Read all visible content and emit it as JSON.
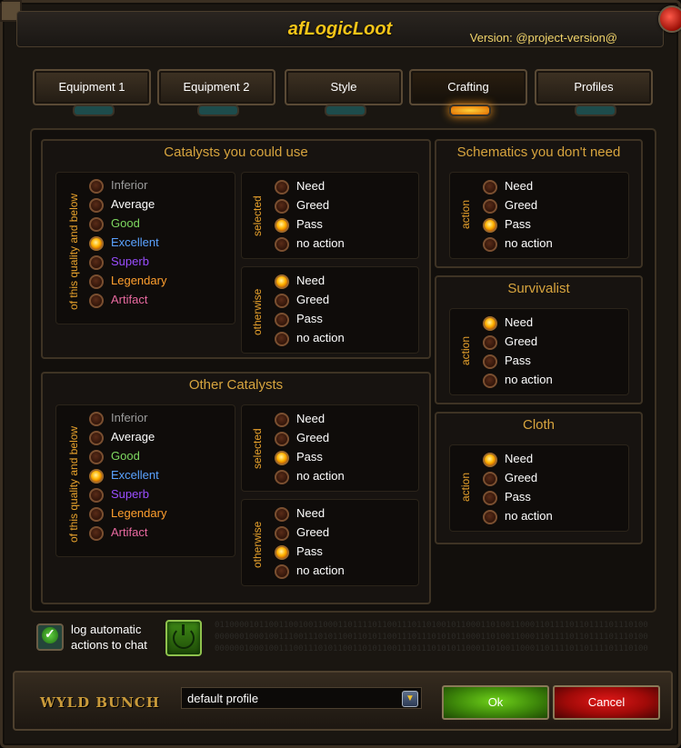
{
  "window": {
    "title": "afLogicLoot",
    "version": "Version: @project-version@"
  },
  "tabs": [
    {
      "label": "Equipment 1",
      "active": false
    },
    {
      "label": "Equipment 2",
      "active": false
    },
    {
      "label": "Style",
      "active": false
    },
    {
      "label": "Crafting",
      "active": true
    },
    {
      "label": "Profiles",
      "active": false
    }
  ],
  "catalysts_use": {
    "title": "Catalysts you could use",
    "quality_label": "of this quality and below",
    "selected_label": "selected",
    "otherwise_label": "otherwise",
    "qualities": [
      "Inferior",
      "Average",
      "Good",
      "Excellent",
      "Superb",
      "Legendary",
      "Artifact"
    ],
    "quality_selected": "Excellent",
    "selected_options": [
      "Need",
      "Greed",
      "Pass",
      "no action"
    ],
    "selected_choice": "Pass",
    "otherwise_options": [
      "Need",
      "Greed",
      "Pass",
      "no action"
    ],
    "otherwise_choice": "Need"
  },
  "catalysts_other": {
    "title": "Other Catalysts",
    "quality_label": "of this quality and below",
    "selected_label": "selected",
    "otherwise_label": "otherwise",
    "qualities": [
      "Inferior",
      "Average",
      "Good",
      "Excellent",
      "Superb",
      "Legendary",
      "Artifact"
    ],
    "quality_selected": "Excellent",
    "selected_options": [
      "Need",
      "Greed",
      "Pass",
      "no action"
    ],
    "selected_choice": "Pass",
    "otherwise_options": [
      "Need",
      "Greed",
      "Pass",
      "no action"
    ],
    "otherwise_choice": "Pass"
  },
  "schematics": {
    "title": "Schematics you don't need",
    "action_label": "action",
    "options": [
      "Need",
      "Greed",
      "Pass",
      "no action"
    ],
    "choice": "Pass"
  },
  "survivalist": {
    "title": "Survivalist",
    "action_label": "action",
    "options": [
      "Need",
      "Greed",
      "Pass",
      "no action"
    ],
    "choice": "Need"
  },
  "cloth": {
    "title": "Cloth",
    "action_label": "action",
    "options": [
      "Need",
      "Greed",
      "Pass",
      "no action"
    ],
    "choice": "Need"
  },
  "quality_colors": {
    "Inferior": "#9d9d9d",
    "Average": "#ffffff",
    "Good": "#7ed860",
    "Excellent": "#5aa2ff",
    "Superb": "#9a4dff",
    "Legendary": "#ff9f2e",
    "Artifact": "#e96aa0"
  },
  "footer": {
    "log_label": "log automatic actions to chat",
    "log_checked": true,
    "binary_text": "0110000101100110010011000110111101100111011010010110001101001100011011110110111101110100000000100010011100111010110011010110011101110101011000110100110001101111011011110111010000000010001001110011101011001101011001110111010101100011010011000110111101101111011101000000001000100111001110101100110101100111011101010110001101001100011011110110111101110100"
  },
  "bottom": {
    "brand": "WYLD BUNCH",
    "profile_value": "default profile",
    "ok_label": "Ok",
    "cancel_label": "Cancel"
  }
}
